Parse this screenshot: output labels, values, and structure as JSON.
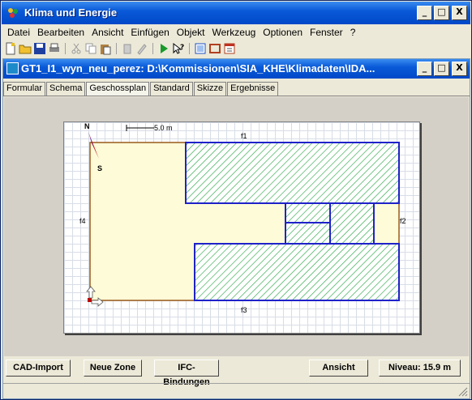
{
  "app": {
    "title": "Klima und Energie",
    "minimize_label": "_",
    "maximize_label": "□",
    "close_label": "X"
  },
  "menu": [
    "Datei",
    "Bearbeiten",
    "Ansicht",
    "Einfügen",
    "Objekt",
    "Werkzeug",
    "Optionen",
    "Fenster",
    "?"
  ],
  "child": {
    "title": "GT1_I1_wyn_neu_perez: D:\\Kommissionen\\SIA_KHE\\Klimadaten\\IDA..."
  },
  "tabs": [
    {
      "label": "Formular",
      "active": false
    },
    {
      "label": "Schema",
      "active": false
    },
    {
      "label": "Geschossplan",
      "active": true
    },
    {
      "label": "Standard",
      "active": false
    },
    {
      "label": "Skizze",
      "active": false
    },
    {
      "label": "Ergebnisse",
      "active": false
    }
  ],
  "plan": {
    "north_label": "N",
    "south_label": "S",
    "scale_label": "5.0 m",
    "facades": {
      "f1": "f1",
      "f2": "f2",
      "f3": "f3",
      "f4": "f4"
    }
  },
  "buttons": {
    "cad_import": "CAD-Import",
    "new_zone": "Neue Zone",
    "ifc": "IFC-Bindungen",
    "view": "Ansicht",
    "level": "Niveau: 15.9 m"
  },
  "colors": {
    "titlebar": "#0a5ad8",
    "zone_fill": "#fefcd8",
    "hatch": "#2fa84a",
    "zone_border": "#1f22c9",
    "building_border": "#9a5a1a"
  }
}
